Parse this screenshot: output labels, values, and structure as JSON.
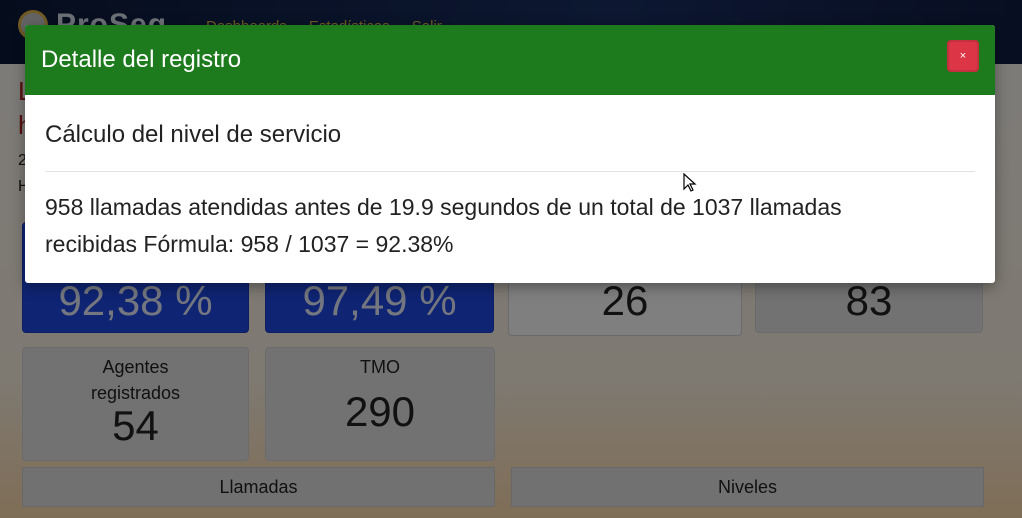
{
  "app": {
    "brand": "ProSeg",
    "nav": [
      "Dashboards",
      "Estadísticas",
      "Salir"
    ]
  },
  "page": {
    "title_line1": "L",
    "title_line2": "h",
    "meta_line1": "2",
    "meta_line2": "H"
  },
  "metrics": {
    "row1": [
      {
        "value": "92,38 %"
      },
      {
        "value": "97,49 %"
      },
      {
        "value": "26"
      },
      {
        "value": "83"
      }
    ],
    "row2": [
      {
        "label": "Agentes registrados",
        "value": "54"
      },
      {
        "label": "TMO",
        "value": "290"
      }
    ]
  },
  "sections": {
    "llamadas": "Llamadas",
    "niveles": "Niveles"
  },
  "modal": {
    "title": "Detalle del registro",
    "close_label": "×",
    "subtitle": "Cálculo del nivel de servicio",
    "text_line1": "958 llamadas atendidas antes de 19.9 segundos de un total de 1037 llamadas",
    "text_line2": "recibidas Fórmula: 958 / 1037 = 92.38%"
  },
  "colors": {
    "modal_header": "#1d7a1d",
    "close_button": "#dc3545",
    "metric_blue": "#1f48e6",
    "title_red": "#b22222"
  }
}
